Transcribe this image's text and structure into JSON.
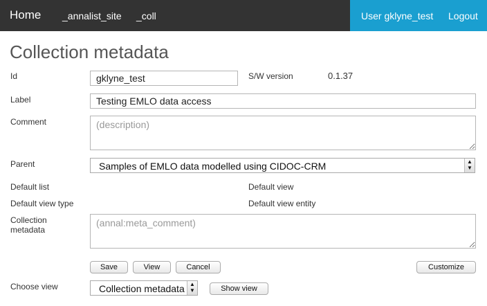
{
  "nav": {
    "home": "Home",
    "site": "_annalist_site",
    "coll": "_coll",
    "user": "User gklyne_test",
    "logout": "Logout"
  },
  "page": {
    "title": "Collection metadata"
  },
  "fields": {
    "id_label": "Id",
    "id_value": "gklyne_test",
    "sw_version_label": "S/W version",
    "sw_version_value": "0.1.37",
    "label_label": "Label",
    "label_value": "Testing EMLO data access",
    "comment_label": "Comment",
    "comment_placeholder": "(description)",
    "parent_label": "Parent",
    "parent_value": "Samples of EMLO data modelled using CIDOC-CRM",
    "default_list_label": "Default list",
    "default_view_label": "Default view",
    "default_view_type_label": "Default view type",
    "default_view_entity_label": "Default view entity",
    "coll_meta_label_1": "Collection",
    "coll_meta_label_2": "metadata",
    "coll_meta_placeholder": "(annal:meta_comment)"
  },
  "buttons": {
    "save": "Save",
    "view": "View",
    "cancel": "Cancel",
    "customize": "Customize",
    "show_view": "Show view"
  },
  "choose_view": {
    "label": "Choose view",
    "selected": "Collection metadata"
  },
  "colors": {
    "topbar": "#333333",
    "user_area": "#1a9fd0"
  }
}
